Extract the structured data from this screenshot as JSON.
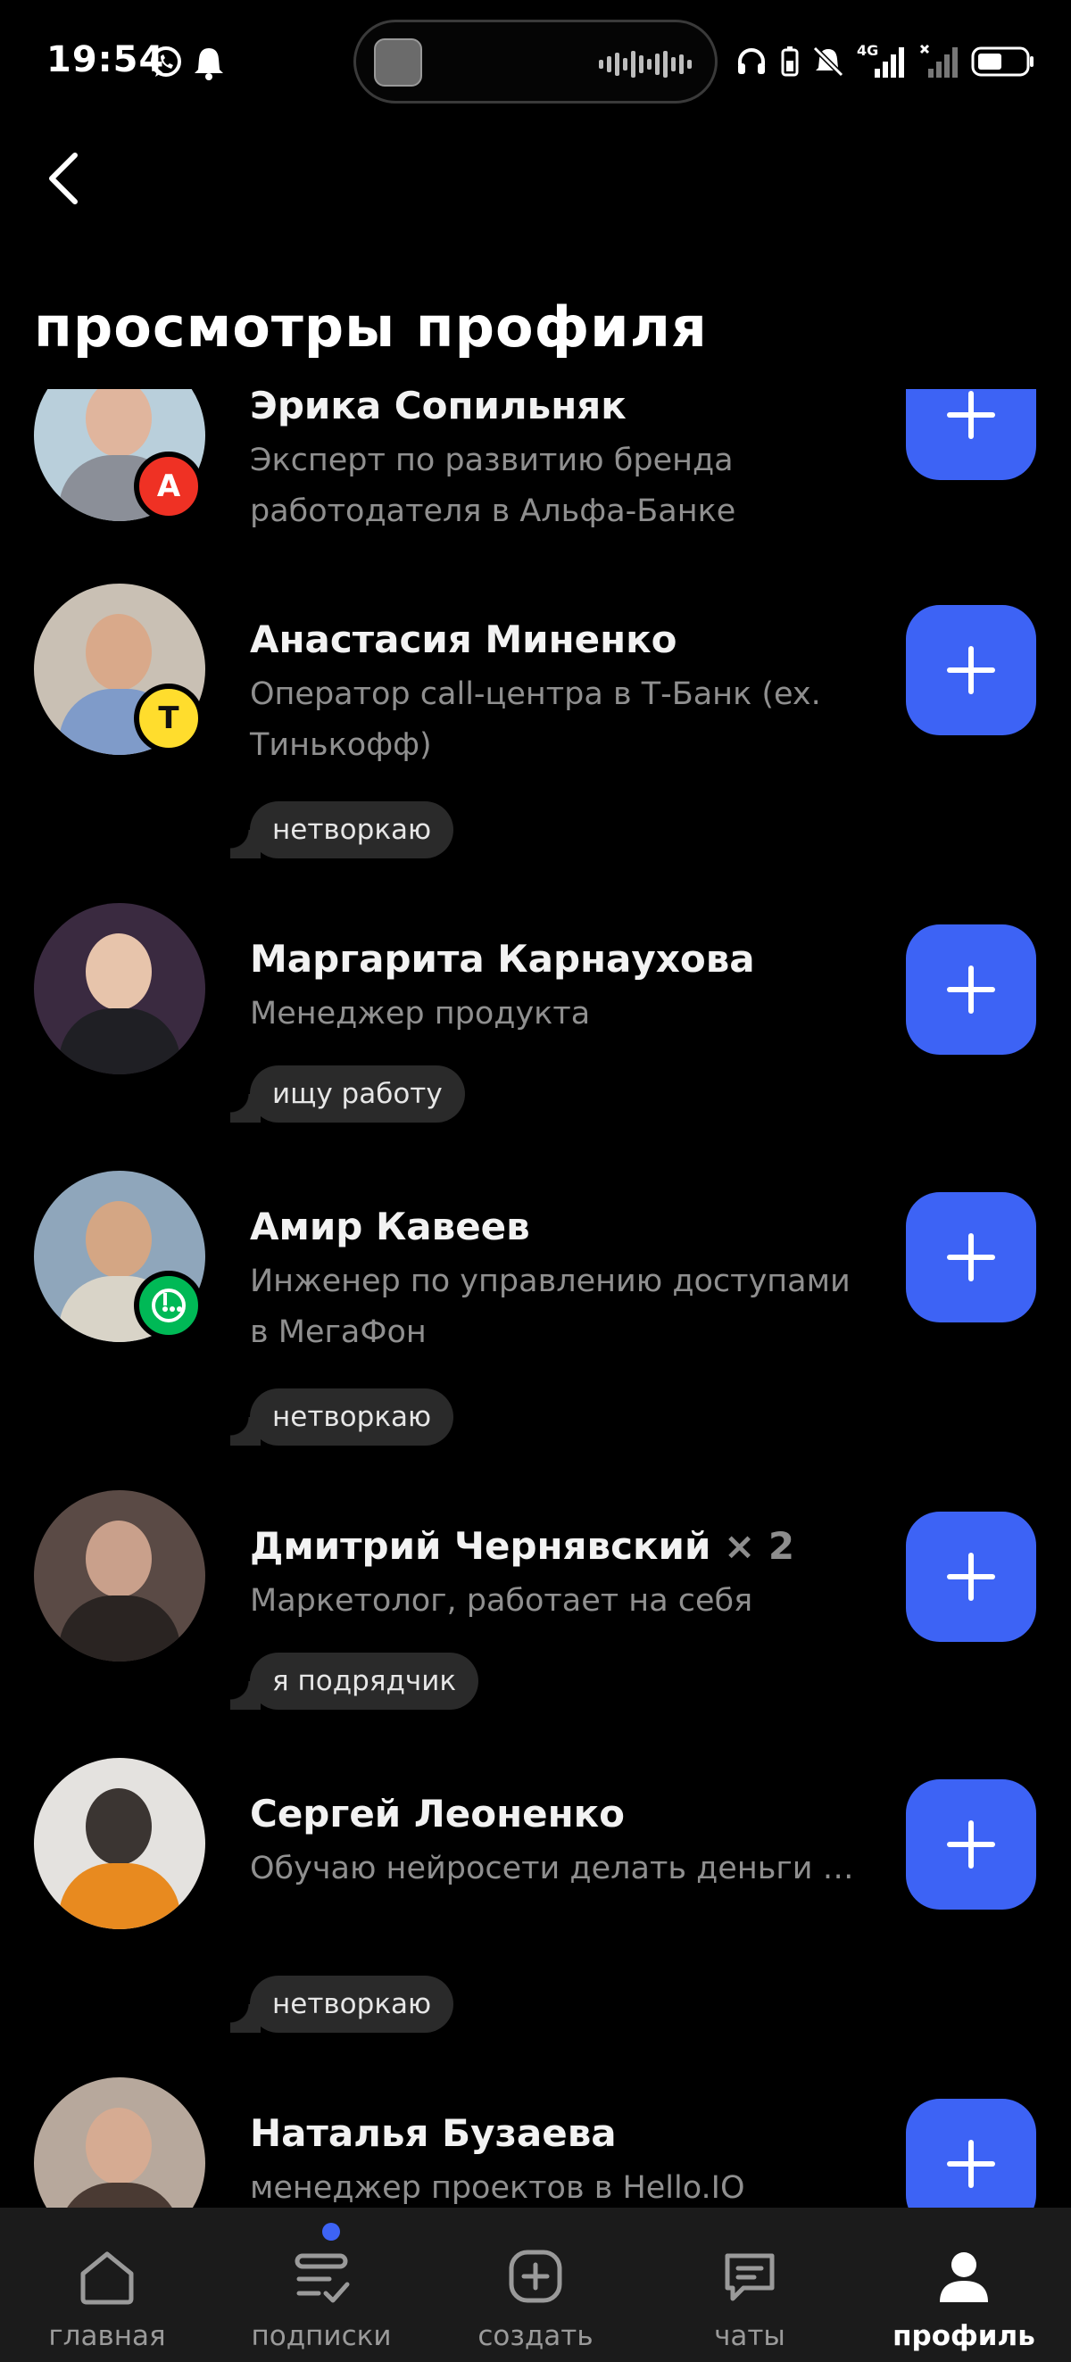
{
  "status_bar": {
    "time": "19:54",
    "network": "4G",
    "icons": [
      "whatsapp-icon",
      "notification-bell-icon",
      "headphones-icon",
      "battery-saver-icon",
      "silent-icon",
      "signal-icon",
      "no-signal-icon",
      "battery-icon"
    ]
  },
  "header": {
    "back_icon": "chevron-left-icon",
    "title": "просмотры профиля"
  },
  "colors": {
    "background": "#000000",
    "accent": "#3d63f5",
    "tag_bg": "#2a2a2a",
    "secondary_text": "#8f8f8f",
    "nav_bg": "#1b1b1b"
  },
  "profiles": [
    {
      "name": "Эрика Сопильняк",
      "count": "",
      "description": "Эксперт по развитию бренда работодателя в Альфа-Банке",
      "tag": "",
      "badge": "А",
      "badge_color": "#ef3124"
    },
    {
      "name": "Анастасия Миненко",
      "count": "",
      "description": "Оператор call-центра в Т-Банк (ex. Тинькофф)",
      "tag": "нетворкаю",
      "badge": "Т",
      "badge_color": "#ffdd2d"
    },
    {
      "name": "Маргарита Карнаухова",
      "count": "",
      "description": "Менеджер продукта",
      "tag": "ищу работу",
      "badge": "",
      "badge_color": ""
    },
    {
      "name": "Амир Кавеев",
      "count": "",
      "description": "Инженер по управлению доступами в МегаФон",
      "tag": "нетворкаю",
      "badge": "megafon",
      "badge_color": "#00b956"
    },
    {
      "name": "Дмитрий Чернявский",
      "count": "× 2",
      "description": "Маркетолог, работает на себя",
      "tag": "я подрядчик",
      "badge": "",
      "badge_color": ""
    },
    {
      "name": "Сергей Леоненко",
      "count": "",
      "description": "Обучаю нейросети делать деньги и разрываюсь между инве...",
      "tag": "нетворкаю",
      "badge": "",
      "badge_color": ""
    },
    {
      "name": "Наталья Бузаева",
      "count": "",
      "description": "менеджер проектов в Hello.IO",
      "tag": "",
      "badge": "",
      "badge_color": ""
    }
  ],
  "add_button_icon": "plus-icon",
  "bottom_nav": {
    "items": [
      {
        "label": "главная",
        "icon": "home-icon",
        "active": false
      },
      {
        "label": "подписки",
        "icon": "subscriptions-icon",
        "active": false,
        "has_dot": true
      },
      {
        "label": "создать",
        "icon": "plus-square-icon",
        "active": false
      },
      {
        "label": "чаты",
        "icon": "chat-icon",
        "active": false
      },
      {
        "label": "профиль",
        "icon": "profile-icon",
        "active": true
      }
    ]
  }
}
